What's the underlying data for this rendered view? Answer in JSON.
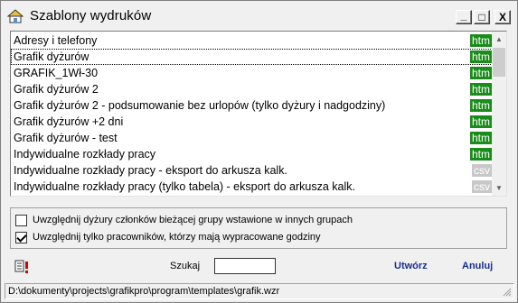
{
  "window": {
    "title": "Szablony wydruków",
    "min_glyph": "_",
    "max_glyph": "□",
    "close_glyph": "X"
  },
  "templates": [
    {
      "name": "Adresy i telefony",
      "format": "htm"
    },
    {
      "name": "Grafik dyżurów",
      "format": "htm",
      "selected": true
    },
    {
      "name": "GRAFIK_1Wł-30",
      "format": "htm"
    },
    {
      "name": "Grafik dyżurów 2",
      "format": "htm"
    },
    {
      "name": "Grafik dyżurów 2 - podsumowanie bez urlopów (tylko dyżury i nadgodziny)",
      "format": "htm"
    },
    {
      "name": "Grafik dyżurów +2 dni",
      "format": "htm"
    },
    {
      "name": "Grafik dyżurów - test",
      "format": "htm"
    },
    {
      "name": "Indywidualne rozkłady pracy",
      "format": "htm"
    },
    {
      "name": "Indywidualne rozkłady pracy - eksport do arkusza kalk.",
      "format": "csv"
    },
    {
      "name": "Indywidualne rozkłady pracy (tylko tabela) - eksport do arkusza kalk.",
      "format": "csv"
    }
  ],
  "options": {
    "include_other_groups": {
      "label": "Uwzględnij dyżury członków bieżącej grupy wstawione w innych grupach",
      "checked": false
    },
    "only_worked_employees": {
      "label": "Uwzględnij tylko pracowników, którzy mają wypracowane godziny",
      "checked": true
    }
  },
  "search": {
    "label": "Szukaj",
    "value": ""
  },
  "actions": {
    "create_label": "Utwórz",
    "cancel_label": "Anuluj"
  },
  "status": {
    "path": "D:\\dokumenty\\projects\\grafikpro\\program\\templates\\grafik.wzr"
  },
  "colors": {
    "htm_badge": "#1a8c1a",
    "csv_badge": "#c8c8c8",
    "action_link": "#1a2f8c"
  }
}
